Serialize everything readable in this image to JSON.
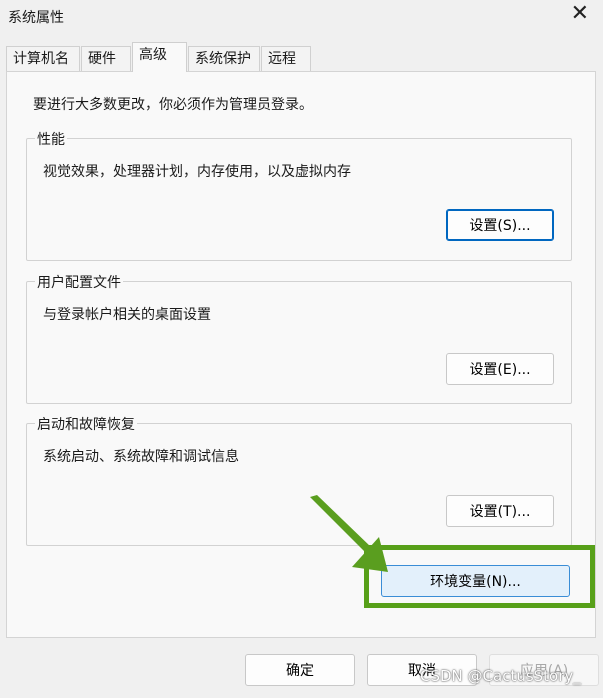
{
  "window": {
    "title": "系统属性",
    "close_glyph": "✕"
  },
  "tabs": [
    "计算机名",
    "硬件",
    "高级",
    "系统保护",
    "远程"
  ],
  "active_tab": "高级",
  "intro_text": "要进行大多数更改，你必须作为管理员登录。",
  "performance": {
    "label": "性能",
    "description": "视觉效果，处理器计划，内存使用，以及虚拟内存",
    "button": "设置(S)..."
  },
  "user_profiles": {
    "label": "用户配置文件",
    "description": "与登录帐户相关的桌面设置",
    "button": "设置(E)..."
  },
  "startup_recovery": {
    "label": "启动和故障恢复",
    "description": "系统启动、系统故障和调试信息",
    "button": "设置(T)..."
  },
  "env_button": "环境变量(N)...",
  "footer": {
    "ok": "确定",
    "cancel": "取消",
    "apply": "应用(A)"
  },
  "watermark": "CSDN @CactusStory_",
  "colors": {
    "highlight": "#57a019",
    "env_button_border": "#3a8dd6",
    "focus": "#0067c0"
  }
}
